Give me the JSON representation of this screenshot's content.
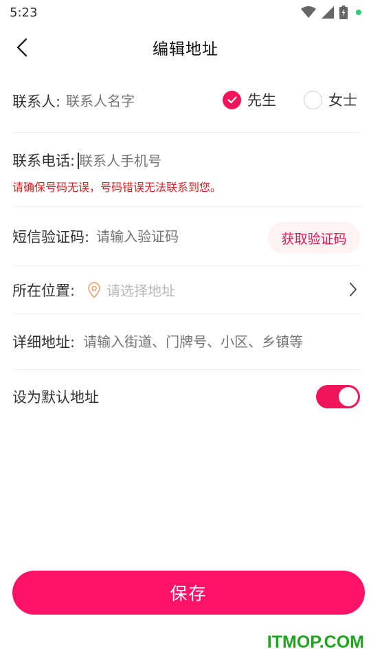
{
  "status_bar": {
    "time": "5:23"
  },
  "nav": {
    "title": "编辑地址"
  },
  "form": {
    "name": {
      "label": "联系人:",
      "placeholder": "联系人名字"
    },
    "gender": {
      "male": {
        "label": "先生",
        "selected": true
      },
      "female": {
        "label": "女士",
        "selected": false
      }
    },
    "phone": {
      "label": "联系电话:",
      "placeholder": "联系人手机号",
      "warning": "请确保号码无误，号码错误无法联系到您。"
    },
    "sms": {
      "label": "短信验证码:",
      "placeholder": "请输入验证码",
      "button": "获取验证码"
    },
    "location": {
      "label": "所在位置:",
      "placeholder": "请选择地址"
    },
    "detail": {
      "label": "详细地址:",
      "placeholder": "请输入街道、门牌号、小区、乡镇等"
    },
    "default_address": {
      "label": "设为默认地址",
      "enabled": true
    }
  },
  "save_button": "保存",
  "watermark": "ITMOP.COM",
  "colors": {
    "accent": "#f0145a",
    "save": "#ff1267",
    "warning": "#e22222",
    "watermark": "#1ea51e"
  }
}
